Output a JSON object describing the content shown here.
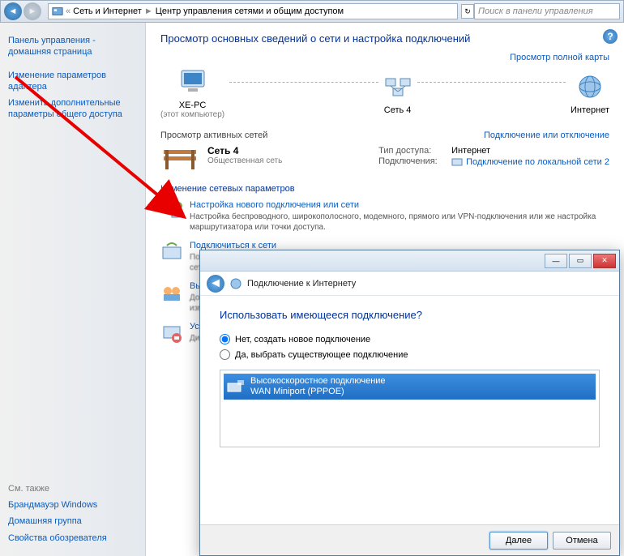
{
  "addressbar": {
    "crumb1": "Сеть и Интернет",
    "crumb2": "Центр управления сетями и общим доступом",
    "search_placeholder": "Поиск в панели управления"
  },
  "sidebar": {
    "links": [
      "Панель управления - домашняя страница",
      "Изменение параметров адаптера",
      "Изменить дополнительные параметры общего доступа"
    ],
    "see_also_title": "См. также",
    "see_also": [
      "Брандмауэр Windows",
      "Домашняя группа",
      "Свойства обозревателя"
    ]
  },
  "content": {
    "heading": "Просмотр основных сведений о сети и настройка подключений",
    "full_map_link": "Просмотр полной карты",
    "node1": "XE-PC",
    "node1_sub": "(этот компьютер)",
    "node2": "Сеть 4",
    "node3": "Интернет",
    "active_networks_label": "Просмотр активных сетей",
    "connect_link": "Подключение или отключение",
    "network_name": "Сеть 4",
    "network_type": "Общественная сеть",
    "access_type_label": "Тип доступа:",
    "access_type_value": "Интернет",
    "connections_label": "Подключения:",
    "connections_value": "Подключение по локальной сети 2",
    "tasks_heading": "Изменение сетевых параметров",
    "task1_title": "Настройка нового подключения или сети",
    "task1_desc": "Настройка беспроводного, широкополосного, модемного, прямого или VPN-подключения или же настройка маршрутизатора или точки доступа.",
    "task2_title": "Подключиться к сети",
    "task2_desc_a": "Подк",
    "task2_desc_b": "сете",
    "task3_title": "Выб",
    "task3_desc_a": "Дост",
    "task3_desc_b": "изме",
    "task4_title": "Устр",
    "task4_desc": "Диаг"
  },
  "dialog": {
    "title": "Подключение к Интернету",
    "question": "Использовать имеющееся подключение?",
    "radio_no": "Нет, создать новое подключение",
    "radio_yes": "Да, выбрать существующее подключение",
    "conn_name": "Высокоскоростное подключение",
    "conn_sub": "WAN Miniport (PPPOE)",
    "next": "Далее",
    "cancel": "Отмена"
  }
}
